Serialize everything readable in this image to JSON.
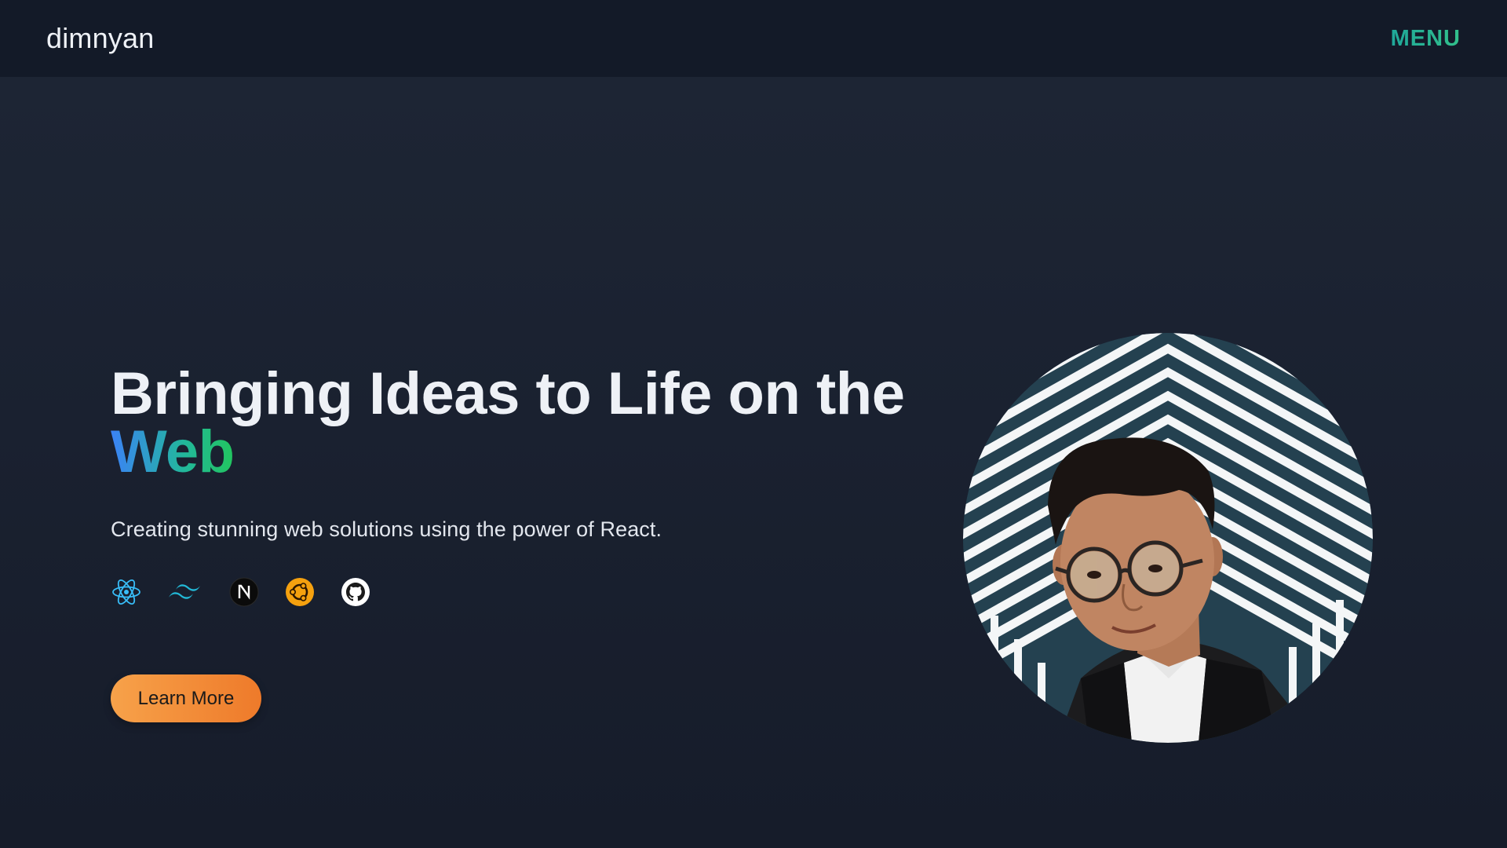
{
  "nav": {
    "brand": "dimnyan",
    "menu_label": "MENU"
  },
  "hero": {
    "headline": "Bringing Ideas to Life on the",
    "headline_accent": "Web",
    "subtitle": "Creating stunning web solutions using the power of React.",
    "cta_label": "Learn More",
    "tech_icons": [
      "react-icon",
      "tailwind-icon",
      "nextjs-icon",
      "ubuntu-icon",
      "github-icon"
    ]
  },
  "colors": {
    "background": "#1b2231",
    "navbar": "#131a28",
    "menu_accent": "#25b392",
    "headline_gradient_start": "#3b82f6",
    "headline_gradient_end": "#22c55e",
    "cta_gradient_start": "#f7a24a",
    "cta_gradient_end": "#ee7a2a"
  }
}
